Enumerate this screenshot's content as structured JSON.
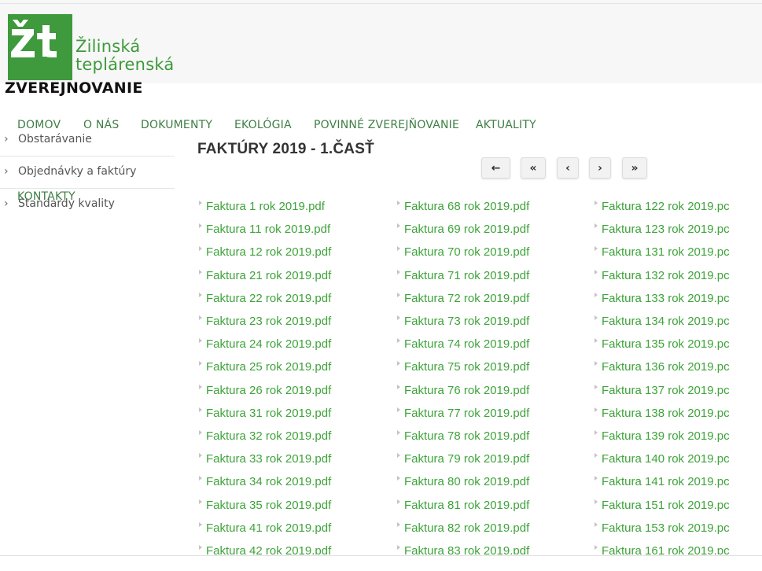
{
  "brand": {
    "logo_line1": "Žilinská",
    "logo_line2": "teplárenská",
    "site_name": "ZVEREJNOVANIE",
    "brand_color": "#3e9a3c"
  },
  "nav": {
    "items": [
      "DOMOV",
      "O NÁS",
      "DOKUMENTY",
      "EKOLÓGIA",
      "POVINNÉ ZVEREJŇOVANIE",
      "AKTUALITY",
      "KONTAKTY"
    ]
  },
  "sidebar": {
    "items": [
      "Obstarávanie",
      "Objednávky a faktúry",
      "Standardy kvality"
    ],
    "chevron_icon": "chevron-right-icon"
  },
  "page": {
    "title": "FAKTÚRY 2019 - 1.ČASŤ"
  },
  "pager": {
    "back": "←",
    "first": "«",
    "prev": "‹",
    "next": "›",
    "last": "»"
  },
  "files": {
    "col1": [
      "Faktura 1 rok 2019.pdf",
      "Faktura 11 rok 2019.pdf",
      "Faktura 12 rok 2019.pdf",
      "Faktura 21 rok 2019.pdf",
      "Faktura 22 rok 2019.pdf",
      "Faktura 23 rok 2019.pdf",
      "Faktura 24 rok 2019.pdf",
      "Faktura 25 rok 2019.pdf",
      "Faktura 26 rok 2019.pdf",
      "Faktura 31 rok 2019.pdf",
      "Faktura 32 rok 2019.pdf",
      "Faktura 33 rok 2019.pdf",
      "Faktura 34 rok 2019.pdf",
      "Faktura 35 rok 2019.pdf",
      "Faktura 41 rok 2019.pdf",
      "Faktura 42 rok 2019.pdf"
    ],
    "col2": [
      "Faktura 68 rok 2019.pdf",
      "Faktura 69 rok 2019.pdf",
      "Faktura 70 rok 2019.pdf",
      "Faktura 71 rok 2019.pdf",
      "Faktura 72 rok 2019.pdf",
      "Faktura 73 rok 2019.pdf",
      "Faktura 74 rok 2019.pdf",
      "Faktura 75 rok 2019.pdf",
      "Faktura 76 rok 2019.pdf",
      "Faktura 77 rok 2019.pdf",
      "Faktura 78 rok 2019.pdf",
      "Faktura 79 rok 2019.pdf",
      "Faktura 80 rok 2019.pdf",
      "Faktura 81 rok 2019.pdf",
      "Faktura 82 rok 2019.pdf",
      "Faktura 83 rok 2019.pdf"
    ],
    "col3": [
      "Faktura 122 rok 2019.pc",
      "Faktura 123 rok 2019.pc",
      "Faktura 131 rok 2019.pc",
      "Faktura 132 rok 2019.pc",
      "Faktura 133 rok 2019.pc",
      "Faktura 134 rok 2019.pc",
      "Faktura 135 rok 2019.pc",
      "Faktura 136 rok 2019.pc",
      "Faktura 137 rok 2019.pc",
      "Faktura 138 rok 2019.pc",
      "Faktura 139 rok 2019.pc",
      "Faktura 140 rok 2019.pc",
      "Faktura 141 rok 2019.pc",
      "Faktura 151 rok 2019.pc",
      "Faktura 153 rok 2019.pc",
      "Faktura 161 rok 2019.pc"
    ]
  }
}
